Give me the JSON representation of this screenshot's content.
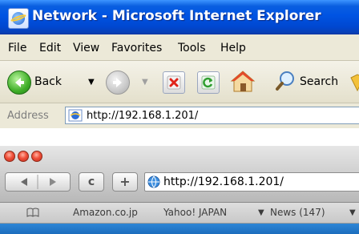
{
  "ie": {
    "window_title": "Network - Microsoft Internet Explorer",
    "menu": [
      "File",
      "Edit",
      "View",
      "Favorites",
      "Tools",
      "Help"
    ],
    "toolbar": {
      "back_label": "Back",
      "search_label": "Search"
    },
    "address_label": "Address",
    "address_value": "http://192.168.1.201/"
  },
  "safari": {
    "reload_glyph": "c",
    "add_glyph": "+",
    "address_value": "http://192.168.1.201/",
    "bookmarks": [
      "Amazon.co.jp",
      "Yahoo! JAPAN",
      "News (147)"
    ],
    "traffic_light_color": "#e8442e"
  },
  "colors": {
    "xp_title_blue": "#0054e3",
    "xp_chrome": "#ece9d8",
    "safari_accent": "#1c6dbd"
  }
}
